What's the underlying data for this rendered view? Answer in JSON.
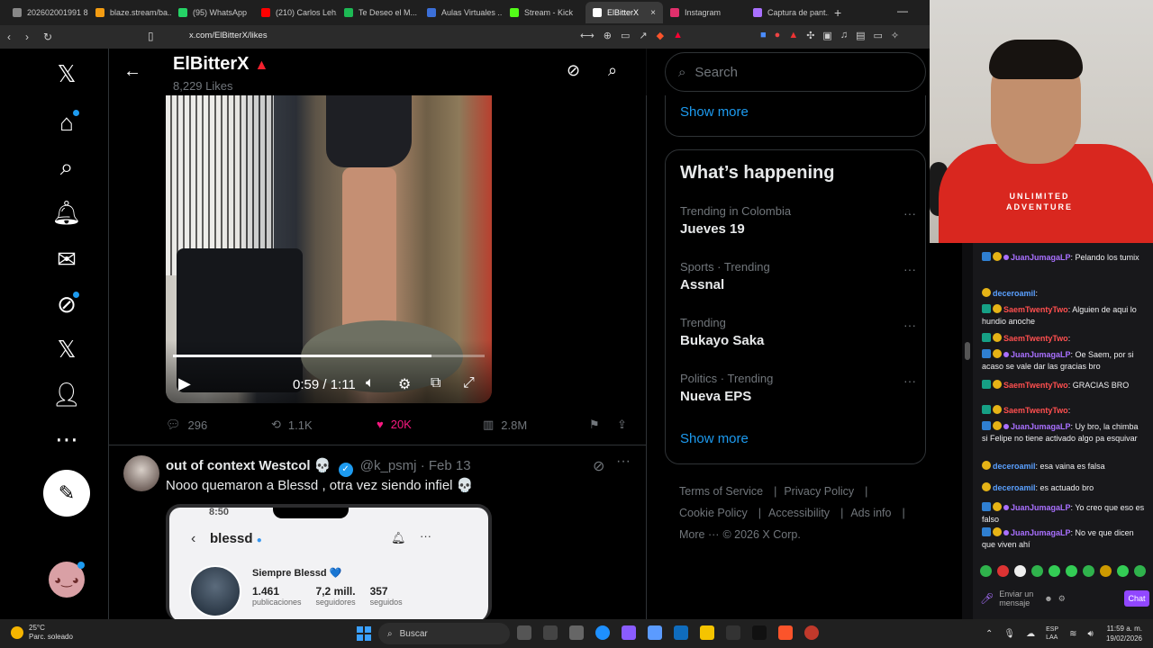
{
  "browser": {
    "tabs": [
      {
        "label": "202602001991 8...",
        "color": "#888"
      },
      {
        "label": "blaze.stream/ba...",
        "color": "#f39c12"
      },
      {
        "label": "(95) WhatsApp",
        "color": "#25d366"
      },
      {
        "label": "(210) Carlos Leh...",
        "color": "#ff0000"
      },
      {
        "label": "Te Deseo el M...",
        "color": "#1db954"
      },
      {
        "label": "Aulas Virtuales ...",
        "color": "#3b6fd8"
      },
      {
        "label": "Stream - Kick",
        "color": "#53fc18"
      },
      {
        "label": "ElBitterX",
        "color": "#ffffff",
        "active": true
      },
      {
        "label": "Instagram",
        "color": "#e1306c"
      },
      {
        "label": "Captura de pant...",
        "color": "#a970ff"
      }
    ],
    "url": "x.com/ElBitterX/likes"
  },
  "profile": {
    "name": "ElBitterX",
    "likes": "8,229 Likes"
  },
  "video": {
    "time": "0:59 / 1:11",
    "progress": 0.83
  },
  "post1_actions": {
    "replies": "296",
    "reposts": "1.1K",
    "likes": "20K",
    "views": "2.8M"
  },
  "post2": {
    "name": "out of context Westcol",
    "emoji": "💀",
    "handle": "@k_psmj",
    "date": "· Feb 13",
    "text": "Nooo quemaron a Blessd , otra vez siendo infiel 💀",
    "screenshot": {
      "time": "8:50",
      "username": "blessd",
      "bio_name": "Siempre Blessd 💙",
      "posts_value": "1.461",
      "posts_label": "publicaciones",
      "followers_value": "7,2 mill.",
      "followers_label": "seguidores",
      "following_value": "357",
      "following_label": "seguidos"
    }
  },
  "sidebar": {
    "search_placeholder": "Search",
    "show_more": "Show more",
    "happening_title": "What’s happening",
    "trends": [
      {
        "context": "Trending in Colombia",
        "title": "Jueves 19"
      },
      {
        "context": "Sports · Trending",
        "title": "Assnal"
      },
      {
        "context": "Trending",
        "title": "Bukayo Saka"
      },
      {
        "context": "Politics · Trending",
        "title": "Nueva EPS"
      }
    ],
    "footer": [
      "Terms of Service",
      "|",
      "Privacy Policy",
      "|",
      "Cookie Policy",
      "|",
      "Accessibility",
      "|",
      "Ads info",
      "|",
      "More ···",
      "© 2026 X Corp."
    ]
  },
  "webcam": {
    "shirt_text": "UNLIMITED ADVENTURE"
  },
  "chat": {
    "messages": [
      {
        "user": "JuanJumagaLP",
        "style": "u1",
        "text": ": Pelando los tumix",
        "badges": [
          "blue",
          "gold",
          "star"
        ]
      },
      {
        "user": "deceroamil",
        "style": "u3",
        "text": ":",
        "badges": [
          "gold"
        ]
      },
      {
        "user": "SaemTwentyTwo",
        "style": "u2",
        "text": ": Alguien de aqui lo hundio anoche",
        "badges": [
          "green",
          "gold"
        ]
      },
      {
        "user": "SaemTwentyTwo",
        "style": "u2",
        "text": ":",
        "badges": [
          "green",
          "gold"
        ]
      },
      {
        "user": "JuanJumagaLP",
        "style": "u1",
        "text": ": Oe Saem, por si acaso se vale dar las gracias bro",
        "badges": [
          "blue",
          "gold",
          "star"
        ]
      },
      {
        "user": "SaemTwentyTwo",
        "style": "u2",
        "text": ": GRACIAS BRO",
        "badges": [
          "green",
          "gold"
        ]
      },
      {
        "user": "SaemTwentyTwo",
        "style": "u2",
        "text": ":",
        "badges": [
          "green",
          "gold"
        ]
      },
      {
        "user": "JuanJumagaLP",
        "style": "u1",
        "text": ": Uy bro, la chimba si Felipe no tiene activado algo pa esquivar",
        "badges": [
          "blue",
          "gold",
          "star"
        ]
      },
      {
        "user": "deceroamil",
        "style": "u3",
        "text": ": esa vaina es falsa",
        "badges": [
          "gold"
        ]
      },
      {
        "user": "deceroamil",
        "style": "u3",
        "text": ": es actuado bro",
        "badges": [
          "gold"
        ]
      },
      {
        "user": "JuanJumagaLP",
        "style": "u1",
        "text": ": Yo creo que eso es falso",
        "badges": [
          "blue",
          "gold",
          "star"
        ]
      },
      {
        "user": "JuanJumagaLP",
        "style": "u1",
        "text": ": No ve que dicen que viven ahí",
        "badges": [
          "blue",
          "gold",
          "star"
        ]
      }
    ],
    "input_placeholder": "Enviar un mensaje",
    "send_label": "Chat"
  },
  "taskbar": {
    "temp": "25°C",
    "weather": "Parc. soleado",
    "search": "Buscar",
    "lang1": "ESP",
    "lang2": "LAA",
    "time": "11:59 a. m.",
    "date": "19/02/2026"
  }
}
